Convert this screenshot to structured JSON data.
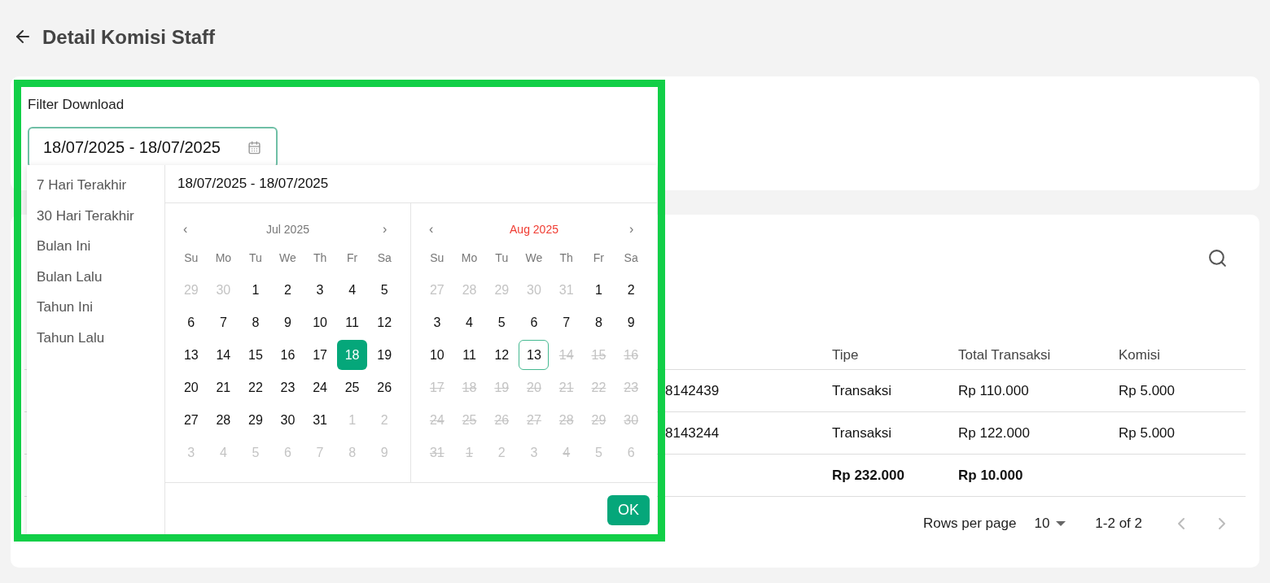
{
  "header": {
    "title": "Detail Komisi Staff"
  },
  "filter": {
    "label": "Filter Download",
    "value": "18/07/2025 - 18/07/2025",
    "focused": true
  },
  "picker": {
    "presets": [
      "7 Hari Terakhir",
      "30 Hari Terakhir",
      "Bulan Ini",
      "Bulan Lalu",
      "Tahun Ini",
      "Tahun Lalu"
    ],
    "range": "18/07/2025 - 18/07/2025",
    "months": [
      {
        "prev": "‹",
        "title": "Jul 2025",
        "next": "›",
        "highlighted": false,
        "weekdays": [
          "Su",
          "Mo",
          "Tu",
          "We",
          "Th",
          "Fr",
          "Sa"
        ],
        "days": [
          {
            "label": "29",
            "kind": "muted",
            "selected": false
          },
          {
            "label": "30",
            "kind": "muted",
            "selected": false
          },
          {
            "label": "1",
            "kind": "normal",
            "selected": false
          },
          {
            "label": "2",
            "kind": "normal",
            "selected": false
          },
          {
            "label": "3",
            "kind": "normal",
            "selected": false
          },
          {
            "label": "4",
            "kind": "normal",
            "selected": false
          },
          {
            "label": "5",
            "kind": "normal",
            "selected": false
          },
          {
            "label": "6",
            "kind": "normal",
            "selected": false
          },
          {
            "label": "7",
            "kind": "normal",
            "selected": false
          },
          {
            "label": "8",
            "kind": "normal",
            "selected": false
          },
          {
            "label": "9",
            "kind": "normal",
            "selected": false
          },
          {
            "label": "10",
            "kind": "normal",
            "selected": false
          },
          {
            "label": "11",
            "kind": "normal",
            "selected": false
          },
          {
            "label": "12",
            "kind": "normal",
            "selected": false
          },
          {
            "label": "13",
            "kind": "normal",
            "selected": false
          },
          {
            "label": "14",
            "kind": "normal",
            "selected": false
          },
          {
            "label": "15",
            "kind": "normal",
            "selected": false
          },
          {
            "label": "16",
            "kind": "normal",
            "selected": false
          },
          {
            "label": "17",
            "kind": "normal",
            "selected": false
          },
          {
            "label": "18",
            "kind": "normal",
            "selected": true
          },
          {
            "label": "19",
            "kind": "normal",
            "selected": false
          },
          {
            "label": "20",
            "kind": "normal",
            "selected": false
          },
          {
            "label": "21",
            "kind": "normal",
            "selected": false
          },
          {
            "label": "22",
            "kind": "normal",
            "selected": false
          },
          {
            "label": "23",
            "kind": "normal",
            "selected": false
          },
          {
            "label": "24",
            "kind": "normal",
            "selected": false
          },
          {
            "label": "25",
            "kind": "normal",
            "selected": false
          },
          {
            "label": "26",
            "kind": "normal",
            "selected": false
          },
          {
            "label": "27",
            "kind": "normal",
            "selected": false
          },
          {
            "label": "28",
            "kind": "normal",
            "selected": false
          },
          {
            "label": "29",
            "kind": "normal",
            "selected": false
          },
          {
            "label": "30",
            "kind": "normal",
            "selected": false
          },
          {
            "label": "31",
            "kind": "normal",
            "selected": false
          },
          {
            "label": "1",
            "kind": "muted",
            "selected": false
          },
          {
            "label": "2",
            "kind": "muted",
            "selected": false
          },
          {
            "label": "3",
            "kind": "muted",
            "selected": false
          },
          {
            "label": "4",
            "kind": "muted",
            "selected": false
          },
          {
            "label": "5",
            "kind": "muted",
            "selected": false
          },
          {
            "label": "6",
            "kind": "muted",
            "selected": false
          },
          {
            "label": "7",
            "kind": "muted",
            "selected": false
          },
          {
            "label": "8",
            "kind": "muted",
            "selected": false
          },
          {
            "label": "9",
            "kind": "muted",
            "selected": false
          }
        ]
      },
      {
        "prev": "‹",
        "title": "Aug 2025",
        "next": "›",
        "highlighted": true,
        "weekdays": [
          "Su",
          "Mo",
          "Tu",
          "We",
          "Th",
          "Fr",
          "Sa"
        ],
        "days": [
          {
            "label": "27",
            "kind": "muted",
            "selected": false
          },
          {
            "label": "28",
            "kind": "muted",
            "selected": false
          },
          {
            "label": "29",
            "kind": "muted",
            "selected": false
          },
          {
            "label": "30",
            "kind": "muted",
            "selected": false
          },
          {
            "label": "31",
            "kind": "muted",
            "selected": false
          },
          {
            "label": "1",
            "kind": "normal",
            "selected": false
          },
          {
            "label": "2",
            "kind": "normal",
            "selected": false
          },
          {
            "label": "3",
            "kind": "normal",
            "selected": false
          },
          {
            "label": "4",
            "kind": "normal",
            "selected": false
          },
          {
            "label": "5",
            "kind": "normal",
            "selected": false
          },
          {
            "label": "6",
            "kind": "normal",
            "selected": false
          },
          {
            "label": "7",
            "kind": "normal",
            "selected": false
          },
          {
            "label": "8",
            "kind": "normal",
            "selected": false
          },
          {
            "label": "9",
            "kind": "normal",
            "selected": false
          },
          {
            "label": "10",
            "kind": "normal",
            "selected": false
          },
          {
            "label": "11",
            "kind": "normal",
            "selected": false
          },
          {
            "label": "12",
            "kind": "normal",
            "selected": false
          },
          {
            "label": "13",
            "kind": "today",
            "selected": false
          },
          {
            "label": "14",
            "kind": "disabled",
            "selected": false
          },
          {
            "label": "15",
            "kind": "disabled",
            "selected": false
          },
          {
            "label": "16",
            "kind": "disabled",
            "selected": false
          },
          {
            "label": "17",
            "kind": "disabled",
            "selected": false
          },
          {
            "label": "18",
            "kind": "disabled",
            "selected": false
          },
          {
            "label": "19",
            "kind": "disabled",
            "selected": false
          },
          {
            "label": "20",
            "kind": "disabled",
            "selected": false
          },
          {
            "label": "21",
            "kind": "disabled",
            "selected": false
          },
          {
            "label": "22",
            "kind": "disabled",
            "selected": false
          },
          {
            "label": "23",
            "kind": "disabled",
            "selected": false
          },
          {
            "label": "24",
            "kind": "disabled",
            "selected": false
          },
          {
            "label": "25",
            "kind": "disabled",
            "selected": false
          },
          {
            "label": "26",
            "kind": "disabled",
            "selected": false
          },
          {
            "label": "27",
            "kind": "disabled",
            "selected": false
          },
          {
            "label": "28",
            "kind": "disabled",
            "selected": false
          },
          {
            "label": "29",
            "kind": "disabled",
            "selected": false
          },
          {
            "label": "30",
            "kind": "disabled",
            "selected": false
          },
          {
            "label": "31",
            "kind": "disabled",
            "selected": false
          },
          {
            "label": "1",
            "kind": "disabled",
            "selected": false
          },
          {
            "label": "2",
            "kind": "muted",
            "selected": false
          },
          {
            "label": "3",
            "kind": "muted",
            "selected": false
          },
          {
            "label": "4",
            "kind": "disabled",
            "selected": false
          },
          {
            "label": "5",
            "kind": "muted",
            "selected": false
          },
          {
            "label": "6",
            "kind": "muted",
            "selected": false
          }
        ]
      }
    ],
    "ok": "OK"
  },
  "table": {
    "header": {
      "tipe": "Tipe",
      "total_transaksi": "Total Transaksi",
      "komisi": "Komisi"
    },
    "rows": [
      {
        "column_1": "8142439",
        "tipe": "Transaksi",
        "total_transaksi": "Rp 110.000",
        "komisi": "Rp 5.000"
      },
      {
        "column_1": "8143244",
        "tipe": "Transaksi",
        "total_transaksi": "Rp 122.000",
        "komisi": "Rp 5.000"
      }
    ],
    "total": {
      "total_transaksi": "Rp 232.000",
      "komisi": "Rp 10.000"
    }
  },
  "pagination": {
    "label": "Rows per page",
    "rows_per_page": "10",
    "range": "1-2 of 2",
    "prev_disabled": true,
    "next_disabled": true
  }
}
